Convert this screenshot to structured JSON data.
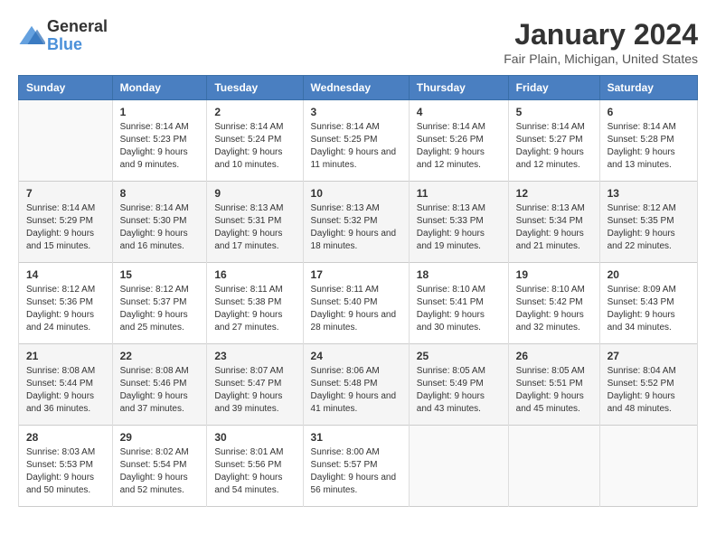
{
  "logo": {
    "general": "General",
    "blue": "Blue"
  },
  "title": "January 2024",
  "subtitle": "Fair Plain, Michigan, United States",
  "days_of_week": [
    "Sunday",
    "Monday",
    "Tuesday",
    "Wednesday",
    "Thursday",
    "Friday",
    "Saturday"
  ],
  "weeks": [
    [
      {
        "day": "",
        "sunrise": "",
        "sunset": "",
        "daylight": ""
      },
      {
        "day": "1",
        "sunrise": "Sunrise: 8:14 AM",
        "sunset": "Sunset: 5:23 PM",
        "daylight": "Daylight: 9 hours and 9 minutes."
      },
      {
        "day": "2",
        "sunrise": "Sunrise: 8:14 AM",
        "sunset": "Sunset: 5:24 PM",
        "daylight": "Daylight: 9 hours and 10 minutes."
      },
      {
        "day": "3",
        "sunrise": "Sunrise: 8:14 AM",
        "sunset": "Sunset: 5:25 PM",
        "daylight": "Daylight: 9 hours and 11 minutes."
      },
      {
        "day": "4",
        "sunrise": "Sunrise: 8:14 AM",
        "sunset": "Sunset: 5:26 PM",
        "daylight": "Daylight: 9 hours and 12 minutes."
      },
      {
        "day": "5",
        "sunrise": "Sunrise: 8:14 AM",
        "sunset": "Sunset: 5:27 PM",
        "daylight": "Daylight: 9 hours and 12 minutes."
      },
      {
        "day": "6",
        "sunrise": "Sunrise: 8:14 AM",
        "sunset": "Sunset: 5:28 PM",
        "daylight": "Daylight: 9 hours and 13 minutes."
      }
    ],
    [
      {
        "day": "7",
        "sunrise": "Sunrise: 8:14 AM",
        "sunset": "Sunset: 5:29 PM",
        "daylight": "Daylight: 9 hours and 15 minutes."
      },
      {
        "day": "8",
        "sunrise": "Sunrise: 8:14 AM",
        "sunset": "Sunset: 5:30 PM",
        "daylight": "Daylight: 9 hours and 16 minutes."
      },
      {
        "day": "9",
        "sunrise": "Sunrise: 8:13 AM",
        "sunset": "Sunset: 5:31 PM",
        "daylight": "Daylight: 9 hours and 17 minutes."
      },
      {
        "day": "10",
        "sunrise": "Sunrise: 8:13 AM",
        "sunset": "Sunset: 5:32 PM",
        "daylight": "Daylight: 9 hours and 18 minutes."
      },
      {
        "day": "11",
        "sunrise": "Sunrise: 8:13 AM",
        "sunset": "Sunset: 5:33 PM",
        "daylight": "Daylight: 9 hours and 19 minutes."
      },
      {
        "day": "12",
        "sunrise": "Sunrise: 8:13 AM",
        "sunset": "Sunset: 5:34 PM",
        "daylight": "Daylight: 9 hours and 21 minutes."
      },
      {
        "day": "13",
        "sunrise": "Sunrise: 8:12 AM",
        "sunset": "Sunset: 5:35 PM",
        "daylight": "Daylight: 9 hours and 22 minutes."
      }
    ],
    [
      {
        "day": "14",
        "sunrise": "Sunrise: 8:12 AM",
        "sunset": "Sunset: 5:36 PM",
        "daylight": "Daylight: 9 hours and 24 minutes."
      },
      {
        "day": "15",
        "sunrise": "Sunrise: 8:12 AM",
        "sunset": "Sunset: 5:37 PM",
        "daylight": "Daylight: 9 hours and 25 minutes."
      },
      {
        "day": "16",
        "sunrise": "Sunrise: 8:11 AM",
        "sunset": "Sunset: 5:38 PM",
        "daylight": "Daylight: 9 hours and 27 minutes."
      },
      {
        "day": "17",
        "sunrise": "Sunrise: 8:11 AM",
        "sunset": "Sunset: 5:40 PM",
        "daylight": "Daylight: 9 hours and 28 minutes."
      },
      {
        "day": "18",
        "sunrise": "Sunrise: 8:10 AM",
        "sunset": "Sunset: 5:41 PM",
        "daylight": "Daylight: 9 hours and 30 minutes."
      },
      {
        "day": "19",
        "sunrise": "Sunrise: 8:10 AM",
        "sunset": "Sunset: 5:42 PM",
        "daylight": "Daylight: 9 hours and 32 minutes."
      },
      {
        "day": "20",
        "sunrise": "Sunrise: 8:09 AM",
        "sunset": "Sunset: 5:43 PM",
        "daylight": "Daylight: 9 hours and 34 minutes."
      }
    ],
    [
      {
        "day": "21",
        "sunrise": "Sunrise: 8:08 AM",
        "sunset": "Sunset: 5:44 PM",
        "daylight": "Daylight: 9 hours and 36 minutes."
      },
      {
        "day": "22",
        "sunrise": "Sunrise: 8:08 AM",
        "sunset": "Sunset: 5:46 PM",
        "daylight": "Daylight: 9 hours and 37 minutes."
      },
      {
        "day": "23",
        "sunrise": "Sunrise: 8:07 AM",
        "sunset": "Sunset: 5:47 PM",
        "daylight": "Daylight: 9 hours and 39 minutes."
      },
      {
        "day": "24",
        "sunrise": "Sunrise: 8:06 AM",
        "sunset": "Sunset: 5:48 PM",
        "daylight": "Daylight: 9 hours and 41 minutes."
      },
      {
        "day": "25",
        "sunrise": "Sunrise: 8:05 AM",
        "sunset": "Sunset: 5:49 PM",
        "daylight": "Daylight: 9 hours and 43 minutes."
      },
      {
        "day": "26",
        "sunrise": "Sunrise: 8:05 AM",
        "sunset": "Sunset: 5:51 PM",
        "daylight": "Daylight: 9 hours and 45 minutes."
      },
      {
        "day": "27",
        "sunrise": "Sunrise: 8:04 AM",
        "sunset": "Sunset: 5:52 PM",
        "daylight": "Daylight: 9 hours and 48 minutes."
      }
    ],
    [
      {
        "day": "28",
        "sunrise": "Sunrise: 8:03 AM",
        "sunset": "Sunset: 5:53 PM",
        "daylight": "Daylight: 9 hours and 50 minutes."
      },
      {
        "day": "29",
        "sunrise": "Sunrise: 8:02 AM",
        "sunset": "Sunset: 5:54 PM",
        "daylight": "Daylight: 9 hours and 52 minutes."
      },
      {
        "day": "30",
        "sunrise": "Sunrise: 8:01 AM",
        "sunset": "Sunset: 5:56 PM",
        "daylight": "Daylight: 9 hours and 54 minutes."
      },
      {
        "day": "31",
        "sunrise": "Sunrise: 8:00 AM",
        "sunset": "Sunset: 5:57 PM",
        "daylight": "Daylight: 9 hours and 56 minutes."
      },
      {
        "day": "",
        "sunrise": "",
        "sunset": "",
        "daylight": ""
      },
      {
        "day": "",
        "sunrise": "",
        "sunset": "",
        "daylight": ""
      },
      {
        "day": "",
        "sunrise": "",
        "sunset": "",
        "daylight": ""
      }
    ]
  ]
}
